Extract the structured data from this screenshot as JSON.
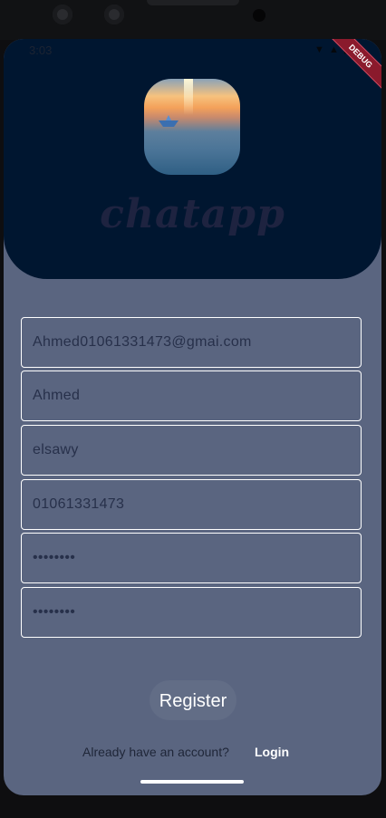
{
  "status_bar": {
    "time": "3:03",
    "icons": "▼ ▲ ▮"
  },
  "debug_banner": "DEBUG",
  "app": {
    "name": "chatapp"
  },
  "form": {
    "fields": [
      {
        "name": "email",
        "value": "Ahmed01061331473@gmai.com"
      },
      {
        "name": "first-name",
        "value": "Ahmed"
      },
      {
        "name": "last-name",
        "value": "elsawy"
      },
      {
        "name": "phone",
        "value": "01061331473"
      },
      {
        "name": "password",
        "value": "••••••••"
      },
      {
        "name": "confirm-password",
        "value": "••••••••"
      }
    ],
    "register_label": "Register",
    "already_text": "Already have an account?",
    "login_label": "Login"
  },
  "colors": {
    "header": "#001630",
    "background": "#5a6580",
    "button": "#626d86",
    "field_border": "#ffffff"
  }
}
